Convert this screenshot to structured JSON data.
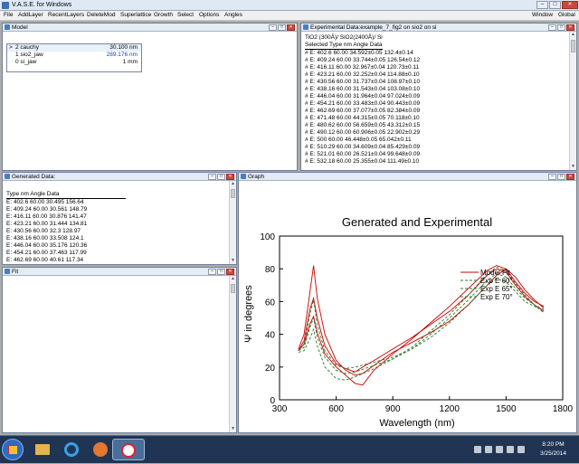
{
  "app": {
    "title": "V.A.S.E. for Windows"
  },
  "menu": {
    "left": [
      "File",
      "AddLayer",
      "RecentLayers",
      "DeleteMod",
      "Superlattice",
      "Growth",
      "Select",
      "Options",
      "Angles"
    ],
    "right": [
      "Window",
      "Global"
    ]
  },
  "model_window": {
    "title": "Model",
    "rows": [
      {
        "marker": ">",
        "name": "2 cauchy",
        "value": "30.100 nm"
      },
      {
        "marker": "",
        "name": "1 sio2_jaw",
        "value": "289.176 nm"
      },
      {
        "marker": "",
        "name": "0 si_jaw",
        "value": "1 mm"
      }
    ]
  },
  "experimental_window": {
    "title": "Experimental Data:example_7_fig2 on sio2 on si",
    "subtitle": "TiO2 (300Å)/ SiO2(2400Å)/ Si",
    "header": "Selected Type  nm  Angle  Data",
    "rows": [
      "# E:  402.6   60.00   34.592±0.05   132.4±0.14",
      "# E:  409.24  60.00   33.744±0.05   126.54±0.12",
      "# E:  416.11  60.00   32.967±0.04   120.73±0.11",
      "# E:  423.21  60.00   32.252±0.04   114.88±0.10",
      "# E:  430.56  60.00   31.737±0.04   108.97±0.10",
      "# E:  438.16  60.00   31.543±0.04   103.08±0.10",
      "# E:  446.04  60.00   31.964±0.04   97.024±0.09",
      "# E:  454.21  60.00   33.483±0.04   90.443±0.09",
      "# E:  462.69  60.00   37.077±0.05   82.384±0.09",
      "# E:  471.48  60.00   44.315±0.05   70.118±0.10",
      "# E:  480.62  60.00   56.659±0.05   43.312±0.15",
      "# E:  490.12  60.00   60.906±0.05   22.902±0.29",
      "# E:  500     60.00   46.448±0.05   65.042±0.11",
      "# E:  510.29  60.00   34.609±0.04   85.429±0.09",
      "# E:  521.01  60.00   26.521±0.04   99.648±0.09",
      "# E:  532.18  60.00   25.355±0.04   111.49±0.10"
    ]
  },
  "generated_window": {
    "title": "Generated Data:",
    "header": "Type  nm  Angle  Data",
    "rows": [
      "E:  402.6   60.00  30.495  156.64",
      "E:  409.24  60.00  30.561  148.79",
      "E:  416.11  60.00  30.876  141.47",
      "E:  423.21  60.00  31.444  134.81",
      "E:  430.56  60.00  32.3    128.97",
      "E:  438.16  60.00  33.508  124.1",
      "E:  446.04  60.00  35.176  120.36",
      "E:  454.21  60.00  37.463  117.99",
      "E:  462.69  60.00  40.61   117.34"
    ]
  },
  "fit_window": {
    "title": "Fit"
  },
  "graph_window": {
    "title": "Graph"
  },
  "chart_data": {
    "type": "line",
    "title": "Generated and Experimental",
    "xlabel": "Wavelength (nm)",
    "ylabel": "Ψ in degrees",
    "xlim": [
      300,
      1800
    ],
    "ylim": [
      0,
      100
    ],
    "xticks": [
      "300",
      "600",
      "900",
      "1200",
      "1500",
      "1800"
    ],
    "yticks": [
      "0",
      "20",
      "40",
      "60",
      "80",
      "100"
    ],
    "grid": false,
    "legend_position": "top-right",
    "series": [
      {
        "name": "Model Fit",
        "color": "#cc0000",
        "style": "solid",
        "x": [
          400,
          430,
          460,
          480,
          500,
          540,
          600,
          650,
          700,
          740,
          800,
          900,
          1000,
          1100,
          1200,
          1300,
          1400,
          1450,
          1500,
          1550,
          1600,
          1650,
          1700
        ],
        "y": [
          31,
          40,
          65,
          82,
          62,
          40,
          24,
          18,
          15,
          16,
          21,
          29,
          35,
          41,
          48,
          58,
          70,
          76,
          80,
          75,
          67,
          61,
          56
        ]
      },
      {
        "name": "Model Fit",
        "color": "#cc0000",
        "style": "solid",
        "x": [
          400,
          430,
          460,
          480,
          500,
          540,
          600,
          650,
          700,
          740,
          800,
          900,
          1000,
          1100,
          1200,
          1300,
          1400,
          1450,
          1500,
          1550,
          1600,
          1650,
          1700
        ],
        "y": [
          30,
          36,
          55,
          62,
          50,
          33,
          22,
          19,
          17,
          20,
          24,
          31,
          38,
          46,
          54,
          64,
          76,
          80,
          78,
          70,
          63,
          58,
          54
        ]
      },
      {
        "name": "Model Fit",
        "color": "#cc0000",
        "style": "solid",
        "x": [
          400,
          430,
          460,
          480,
          500,
          540,
          600,
          650,
          700,
          740,
          800,
          900,
          1000,
          1100,
          1200,
          1300,
          1400,
          1450,
          1500,
          1550,
          1600,
          1650,
          1700
        ],
        "y": [
          30,
          34,
          46,
          51,
          41,
          28,
          20,
          15,
          10,
          9,
          18,
          28,
          37,
          47,
          57,
          68,
          79,
          82,
          80,
          72,
          65,
          60,
          57
        ]
      },
      {
        "name": "Exp E 60°",
        "color": "#2a7a2a",
        "style": "dashed",
        "x": [
          400,
          430,
          460,
          480,
          500,
          540,
          600,
          650,
          700,
          800,
          900,
          1000,
          1100,
          1200,
          1300,
          1400,
          1450,
          1500,
          1550,
          1600,
          1650,
          1700
        ],
        "y": [
          30,
          34,
          52,
          61,
          46,
          30,
          21,
          19,
          20,
          23,
          26,
          31,
          38,
          47,
          58,
          70,
          74,
          72,
          66,
          60,
          57,
          55
        ]
      },
      {
        "name": "Exp E 65°",
        "color": "#2a7a2a",
        "style": "dashed",
        "x": [
          400,
          430,
          460,
          480,
          500,
          540,
          600,
          650,
          700,
          800,
          900,
          1000,
          1100,
          1200,
          1300,
          1400,
          1450,
          1500,
          1550,
          1600,
          1650,
          1700
        ],
        "y": [
          30,
          32,
          44,
          50,
          38,
          26,
          18,
          16,
          17,
          21,
          25,
          31,
          40,
          50,
          61,
          73,
          77,
          75,
          68,
          62,
          58,
          55
        ]
      },
      {
        "name": "Exp E 70°",
        "color": "#2a7a2a",
        "style": "dashed",
        "x": [
          400,
          430,
          460,
          480,
          500,
          540,
          600,
          650,
          700,
          800,
          900,
          1000,
          1100,
          1200,
          1300,
          1400,
          1450,
          1500,
          1550,
          1600,
          1650,
          1700
        ],
        "y": [
          29,
          30,
          37,
          43,
          33,
          20,
          13,
          12,
          14,
          19,
          25,
          32,
          42,
          52,
          64,
          77,
          81,
          79,
          71,
          64,
          58,
          53
        ]
      }
    ],
    "legend": [
      {
        "label": "Model Fit",
        "color": "#cc0000",
        "style": "solid"
      },
      {
        "label": "Exp E 60°",
        "color": "#2a7a2a",
        "style": "dashed"
      },
      {
        "label": "Exp E 65°",
        "color": "#2a7a2a",
        "style": "dashed"
      },
      {
        "label": "Exp E 70°",
        "color": "#2a7a2a",
        "style": "dashed"
      }
    ]
  },
  "taskbar": {
    "time": "8:20 PM",
    "date": "3/25/2014"
  }
}
